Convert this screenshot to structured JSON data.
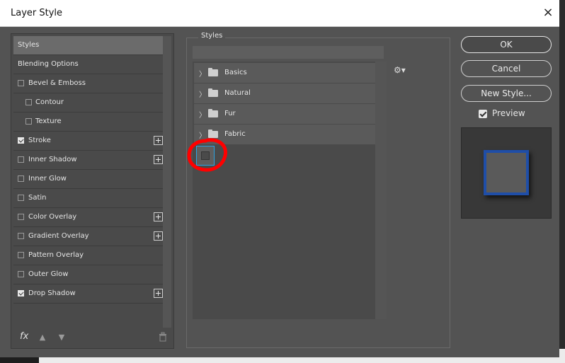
{
  "window": {
    "title": "Layer Style",
    "close_glyph": "×"
  },
  "left_panel": {
    "items": [
      {
        "label": "Styles",
        "has_checkbox": false,
        "checked": false,
        "has_plus": false,
        "selected": true,
        "indent": false
      },
      {
        "label": "Blending Options",
        "has_checkbox": false,
        "checked": false,
        "has_plus": false,
        "selected": false,
        "indent": false
      },
      {
        "label": "Bevel & Emboss",
        "has_checkbox": true,
        "checked": false,
        "has_plus": false,
        "selected": false,
        "indent": false
      },
      {
        "label": "Contour",
        "has_checkbox": true,
        "checked": false,
        "has_plus": false,
        "selected": false,
        "indent": true
      },
      {
        "label": "Texture",
        "has_checkbox": true,
        "checked": false,
        "has_plus": false,
        "selected": false,
        "indent": true
      },
      {
        "label": "Stroke",
        "has_checkbox": true,
        "checked": true,
        "has_plus": true,
        "selected": false,
        "indent": false
      },
      {
        "label": "Inner Shadow",
        "has_checkbox": true,
        "checked": false,
        "has_plus": true,
        "selected": false,
        "indent": false
      },
      {
        "label": "Inner Glow",
        "has_checkbox": true,
        "checked": false,
        "has_plus": false,
        "selected": false,
        "indent": false
      },
      {
        "label": "Satin",
        "has_checkbox": true,
        "checked": false,
        "has_plus": false,
        "selected": false,
        "indent": false
      },
      {
        "label": "Color Overlay",
        "has_checkbox": true,
        "checked": false,
        "has_plus": true,
        "selected": false,
        "indent": false
      },
      {
        "label": "Gradient Overlay",
        "has_checkbox": true,
        "checked": false,
        "has_plus": true,
        "selected": false,
        "indent": false
      },
      {
        "label": "Pattern Overlay",
        "has_checkbox": true,
        "checked": false,
        "has_plus": false,
        "selected": false,
        "indent": false
      },
      {
        "label": "Outer Glow",
        "has_checkbox": true,
        "checked": false,
        "has_plus": false,
        "selected": false,
        "indent": false
      },
      {
        "label": "Drop Shadow",
        "has_checkbox": true,
        "checked": true,
        "has_plus": true,
        "selected": false,
        "indent": false
      }
    ],
    "footer": {
      "fx_label": "fx",
      "up_icon": "arrow-up-icon",
      "down_icon": "arrow-down-icon",
      "trash_icon": "trash-icon"
    }
  },
  "styles_panel": {
    "legend": "Styles",
    "folders": [
      {
        "label": "Basics"
      },
      {
        "label": "Natural"
      },
      {
        "label": "Fur"
      },
      {
        "label": "Fabric"
      }
    ],
    "gear_icon": "gear-icon"
  },
  "right_panel": {
    "ok_label": "OK",
    "cancel_label": "Cancel",
    "new_style_label": "New Style...",
    "preview_label": "Preview",
    "preview_checked": true
  },
  "colors": {
    "dialog_bg": "#535353",
    "selection_border": "#2fa3e0",
    "annotation": "#ff0000",
    "preview_stroke": "#1f4ea8",
    "preview_fill": "#5a5a5a"
  }
}
